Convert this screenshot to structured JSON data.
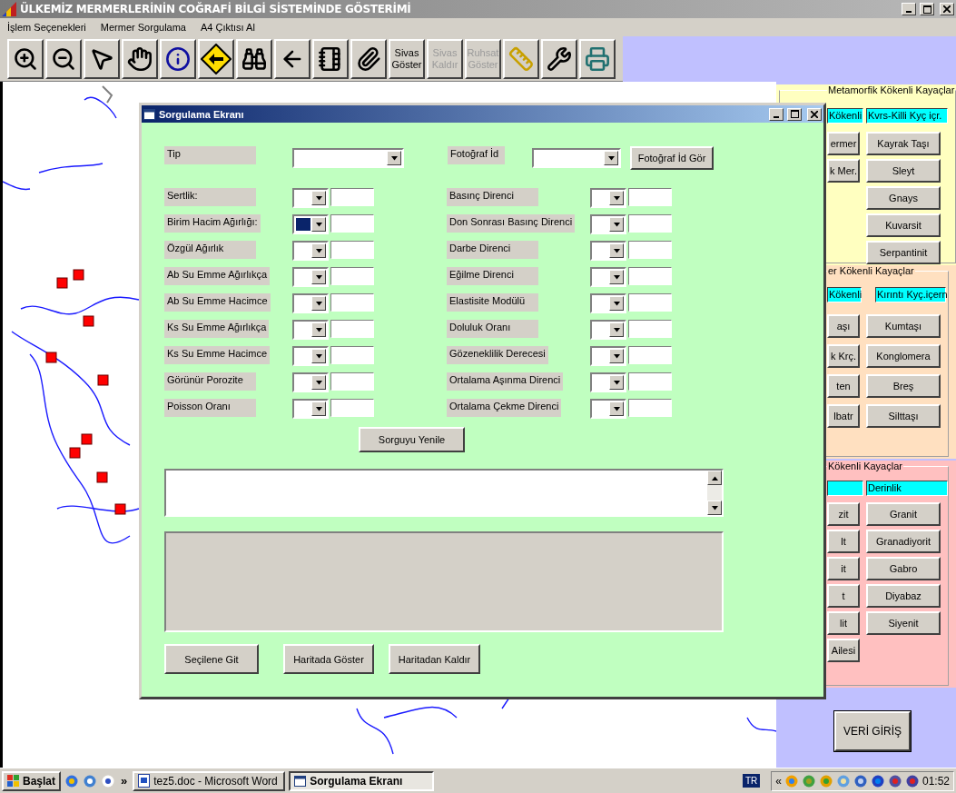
{
  "window": {
    "title": "ÜLKEMİZ MERMERLERİNİN COĞRAFİ BİLGİ SİSTEMİNDE GÖSTERİMİ"
  },
  "menu": [
    "İşlem Seçenekleri",
    "Mermer Sorgulama",
    "A4 Çıktısı Al"
  ],
  "toolbar": [
    {
      "kind": "icon"
    },
    {
      "kind": "icon"
    },
    {
      "kind": "icon"
    },
    {
      "kind": "icon"
    },
    {
      "kind": "icon"
    },
    {
      "kind": "icon"
    },
    {
      "kind": "icon"
    },
    {
      "kind": "icon"
    },
    {
      "kind": "icon"
    },
    {
      "kind": "icon"
    },
    {
      "kind": "text",
      "label": "Sivas Göster",
      "disabled": false
    },
    {
      "kind": "text",
      "label": "Sivas Kaldır",
      "disabled": true
    },
    {
      "kind": "text",
      "label": "Ruhsat Göster",
      "disabled": true
    },
    {
      "kind": "icon"
    },
    {
      "kind": "icon"
    },
    {
      "kind": "icon"
    }
  ],
  "dialog": {
    "title": "Sorgulama Ekranı",
    "tip_label": "Tip",
    "photo_id_label": "Fotoğraf İd",
    "photo_id_button": "Fotoğraf İd Gör",
    "left_fields": [
      {
        "label": "Sertlik:",
        "highlighted": false
      },
      {
        "label": "Birim Hacim Ağırlığı:",
        "highlighted": true
      },
      {
        "label": "Özgül Ağırlık",
        "highlighted": false
      },
      {
        "label": "Ab Su Emme Ağırlıkça",
        "highlighted": false
      },
      {
        "label": "Ab Su Emme Hacimce",
        "highlighted": false
      },
      {
        "label": "Ks Su Emme Ağırlıkça",
        "highlighted": false
      },
      {
        "label": "Ks Su Emme Hacimce",
        "highlighted": false
      },
      {
        "label": "Görünür Porozite",
        "highlighted": false
      },
      {
        "label": "Poisson Oranı",
        "highlighted": false
      }
    ],
    "right_fields": [
      {
        "label": "Basınç Direnci"
      },
      {
        "label": "Don Sonrası Basınç Direnci"
      },
      {
        "label": "Darbe Direnci"
      },
      {
        "label": "Eğilme Direnci"
      },
      {
        "label": "Elastisite Modülü"
      },
      {
        "label": "Doluluk Oranı"
      },
      {
        "label": "Gözeneklilik Derecesi"
      },
      {
        "label": "Ortalama Aşınma Direnci"
      },
      {
        "label": "Ortalama Çekme Direnci"
      }
    ],
    "refresh_button": "Sorguyu Yenile",
    "buttons": [
      "Seçilene Git",
      "Haritada Göster",
      "Haritadan Kaldır"
    ]
  },
  "right_panel": {
    "groups": [
      {
        "legend": "Metamorfik Kökenli Kayaçlar",
        "left_field": "Kökenli",
        "right_field": "Kvrs-Killi Kyç içr.",
        "left_buttons": [
          "ermer",
          "k Mer."
        ],
        "right_buttons": [
          "Kayrak Taşı",
          "Sleyt",
          "Gnays",
          "Kuvarsit",
          "Serpantinit"
        ]
      },
      {
        "legend": "er Kökenli Kayaçlar",
        "left_field": "Kökenli",
        "right_field": "Kırıntı Kyç.içern",
        "left_buttons": [
          "aşı",
          "k Krç.",
          "ten",
          "lbatr"
        ],
        "right_buttons": [
          "Kumtaşı",
          "Konglomera",
          "Breş",
          "Silttaşı"
        ]
      },
      {
        "legend": "Kökenli Kayaçlar",
        "right_field": "Derinlik",
        "left_buttons": [
          "zit",
          "lt",
          "it",
          "t",
          "lit",
          "Ailesi"
        ],
        "right_buttons": [
          "Granit",
          "Granadiyorit",
          "Gabro",
          "Diyabaz",
          "Siyenit"
        ]
      }
    ],
    "data_entry_button": "VERİ GİRİŞ"
  },
  "taskbar": {
    "start": "Başlat",
    "more": "»",
    "tasks": [
      {
        "label": "tez5.doc - Microsoft Word",
        "selected": false
      },
      {
        "label": "Sorgulama Ekranı",
        "selected": true
      }
    ],
    "language": "TR",
    "tray_expand": "«",
    "clock": "01:52"
  }
}
